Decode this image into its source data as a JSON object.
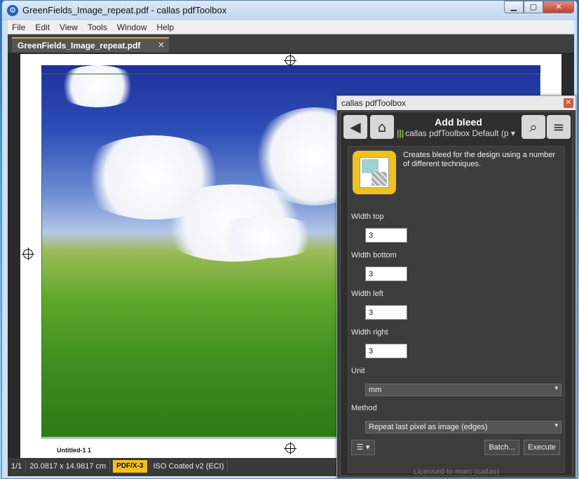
{
  "window": {
    "title": "GreenFields_Image_repeat.pdf - callas pdfToolbox"
  },
  "menubar": {
    "items": [
      "File",
      "Edit",
      "View",
      "Tools",
      "Window",
      "Help"
    ]
  },
  "document": {
    "tab_label": "GreenFields_Image_repeat.pdf",
    "strip_text": "Untitled-1   1"
  },
  "statusbar": {
    "page": "1/1",
    "size": "20.0817 x 14.9817 cm",
    "standard_badge": "PDF/X-3",
    "color_profile": "ISO Coated v2 (ECI)"
  },
  "panel": {
    "title": "callas pdfToolbox",
    "fixup_title": "Add bleed",
    "profile": "callas pdfToolbox Default (p",
    "description": "Creates bleed for the design using a number of different techniques.",
    "fields": {
      "width_top": {
        "label": "Width top",
        "value": "3"
      },
      "width_bottom": {
        "label": "Width bottom",
        "value": "3"
      },
      "width_left": {
        "label": "Width left",
        "value": "3"
      },
      "width_right": {
        "label": "Width right",
        "value": "3"
      },
      "unit": {
        "label": "Unit",
        "value": "mm"
      },
      "method": {
        "label": "Method",
        "value": "Repeat last pixel as image (edges)"
      }
    },
    "batch_label": "Batch...",
    "execute_label": "Execute",
    "license_text": "Licensed to marc (callas)"
  }
}
